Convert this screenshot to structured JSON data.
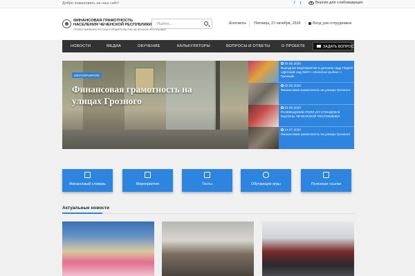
{
  "topbar": {
    "welcome": "Добро пожаловать на наш сайт!",
    "social": [
      "f",
      "𝕥"
    ],
    "impaired_version": "Версия для слабовидящих"
  },
  "logo": {
    "line1": "ФИНАНСОВАЯ ГРАМОТНОСТЬ",
    "line2": "НАСЕЛЕНИЯ ЧЕЧЕНСКОЙ РЕСПУБЛИКИ",
    "line3": "ПРОЕКТ МИНФИНА РОССИИ И ПРАВИТЕЛЬСТВА ЧЕЧЕНСКОЙ РЕСПУБЛИКИ"
  },
  "search": {
    "placeholder": "Найти..."
  },
  "header": {
    "contacts": "Контакты",
    "date": "Пятница, 23 октября, 2020",
    "staff_login": "Вход для сотрудников"
  },
  "nav": {
    "items": [
      "НОВОСТИ",
      "МЕДИА",
      "ОБУЧЕНИЕ",
      "КАЛЬКУЛЯТОРЫ",
      "ВОПРОСЫ И ОТВЕТЫ",
      "О ПРОЕКТЕ"
    ],
    "ask_button": "ЗАДАТЬ ВОПРОС"
  },
  "hero": {
    "category": "МЕРОПРИЯТИЕ",
    "title": "Финансовая грамотность на улицах Грозного"
  },
  "side_news": [
    {
      "date": "30.08.2020",
      "title": "Выездное мероприятие в детском саду ГБДОУ «Детский сад №97» «Золотые рыбки» г. Грозный."
    },
    {
      "date": "25.08.2020",
      "title": "Финансовая грамотность на улицах Грозного"
    },
    {
      "date": "18.08.2020",
      "title": "РАЗМЕЩЕНИЕ РОЛЛ-АП СТЕНДОВ В КЦСОНы ЧЕЧЕНСКОЙ РЕСПУБЛИКИ"
    },
    {
      "date": "14.07.2020",
      "title": "Финансовая грамотность на улицах Грозного"
    }
  ],
  "tiles": [
    {
      "label": "Финансовый словарь",
      "icon": "book-icon"
    },
    {
      "label": "Мероприятия",
      "icon": "calendar-icon"
    },
    {
      "label": "Тесты",
      "icon": "checklist-icon"
    },
    {
      "label": "Обучающие игры",
      "icon": "gamepad-icon"
    },
    {
      "label": "Полезные ссылки",
      "icon": "external-link-icon"
    }
  ],
  "latest": {
    "title": "Актуальные новости"
  },
  "colors": {
    "accent": "#2e85e0",
    "nav_bg": "#333333"
  }
}
